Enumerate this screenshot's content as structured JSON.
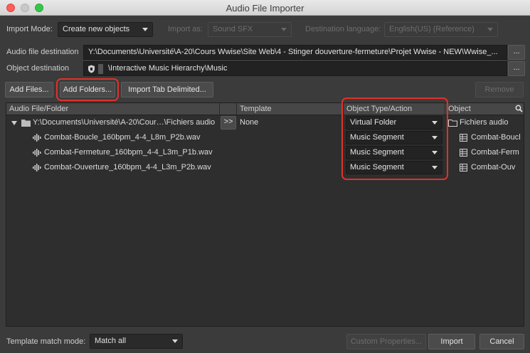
{
  "window": {
    "title": "Audio File Importer"
  },
  "import_mode": {
    "label": "Import Mode:",
    "value": "Create new objects"
  },
  "import_as": {
    "label": "Import as:",
    "value": "Sound SFX"
  },
  "destination_language": {
    "label": "Destination language:",
    "value": "English(US) (Reference)"
  },
  "audio_destination": {
    "label": "Audio file destination",
    "value": "Y:\\Documents\\Université\\A-20\\Cours Wwise\\Site Web\\4 - Stinger douverture-fermeture\\Projet Wwise - NEW\\Wwise_...",
    "browse": "..."
  },
  "object_destination": {
    "label": "Object destination",
    "value": "\\Interactive Music Hierarchy\\Music",
    "browse": "..."
  },
  "buttons": {
    "add_files": "Add Files...",
    "add_folders": "Add Folders...",
    "import_tab": "Import Tab Delimited...",
    "remove": "Remove",
    "custom_properties": "Custom Properties...",
    "import": "Import",
    "cancel": "Cancel"
  },
  "table": {
    "columns": [
      "Audio File/Folder",
      "Template",
      "Object Type/Action",
      "Object"
    ],
    "folder": {
      "path": "Y:\\Documents\\Université\\A-20\\Cour…\\Fichiers audio",
      "apply": ">>",
      "template": "None",
      "type": "Virtual Folder",
      "object": "Fichiers audio"
    },
    "files": [
      {
        "name": "Combat-Boucle_160bpm_4-4_L8m_P2b.wav",
        "type": "Music Segment",
        "object": "Combat-Boucl"
      },
      {
        "name": "Combat-Fermeture_160bpm_4-4_L3m_P1b.wav",
        "type": "Music Segment",
        "object": "Combat-Ferm"
      },
      {
        "name": "Combat-Ouverture_160bpm_4-4_L3m_P2b.wav",
        "type": "Music Segment",
        "object": "Combat-Ouv"
      }
    ]
  },
  "template_match": {
    "label": "Template match mode:",
    "value": "Match all"
  },
  "colors": {
    "highlight": "#e0312a",
    "background": "#3b3b3b"
  }
}
